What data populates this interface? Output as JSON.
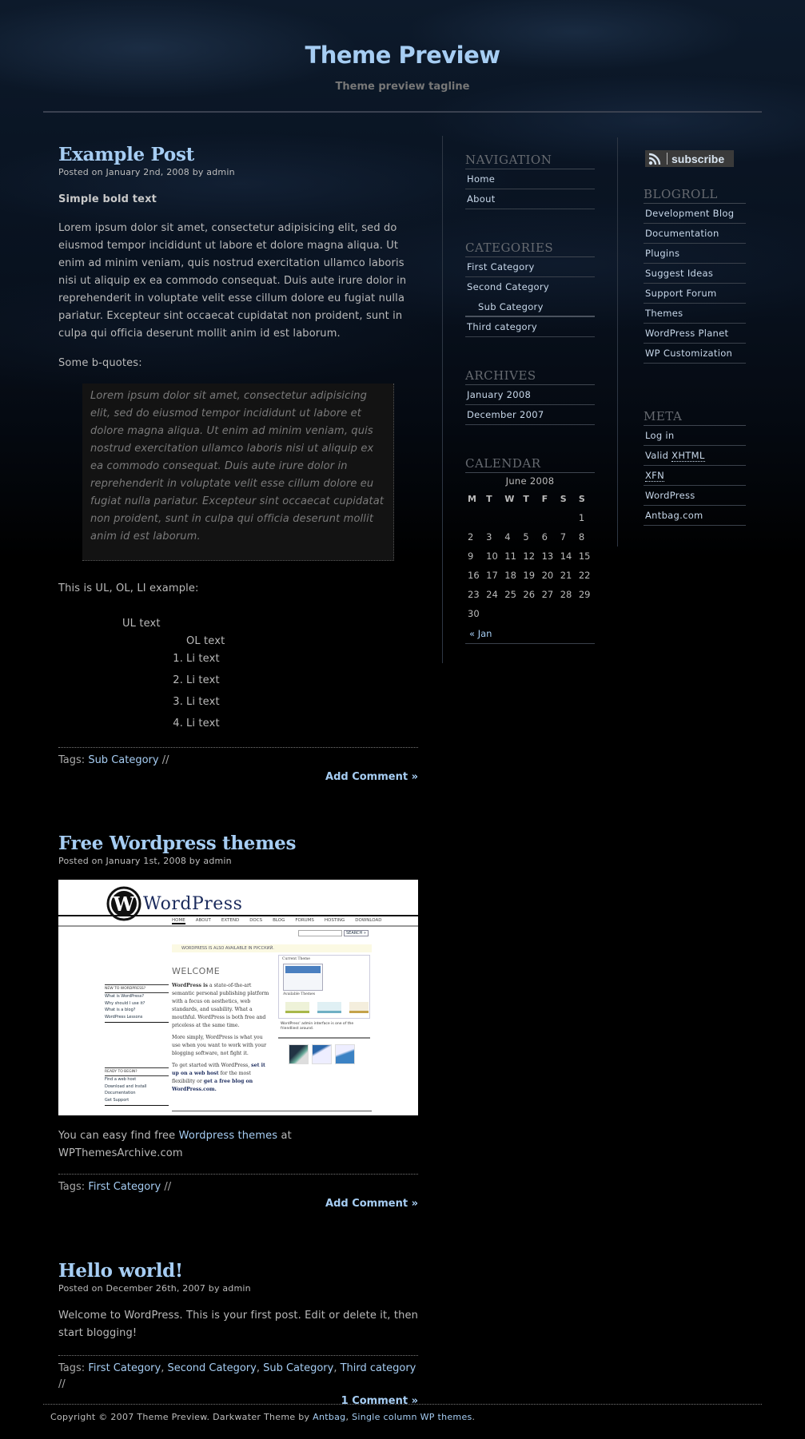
{
  "header": {
    "title": "Theme Preview",
    "tagline": "Theme preview tagline"
  },
  "posts": [
    {
      "title": "Example Post",
      "meta": "Posted on January 2nd, 2008 by admin",
      "bold_text": "Simple bold text",
      "paragraph": "Lorem ipsum dolor sit amet, consectetur adipisicing elit, sed do eiusmod tempor incididunt ut labore et dolore magna aliqua. Ut enim ad minim veniam, quis nostrud exercitation ullamco laboris nisi ut aliquip ex ea commodo consequat. Duis aute irure dolor in reprehenderit in voluptate velit esse cillum dolore eu fugiat nulla pariatur. Excepteur sint occaecat cupidatat non proident, sunt in culpa qui officia deserunt mollit anim id est laborum.",
      "bquote_intro": "Some b-quotes:",
      "blockquote": "Lorem ipsum dolor sit amet, consectetur adipisicing elit, sed do eiusmod tempor incididunt ut labore et dolore magna aliqua. Ut enim ad minim veniam, quis nostrud exercitation ullamco laboris nisi ut aliquip ex ea commodo consequat. Duis aute irure dolor in reprehenderit in voluptate velit esse cillum dolore eu fugiat nulla pariatur. Excepteur sint occaecat cupidatat non proident, sunt in culpa qui officia deserunt mollit anim id est laborum.",
      "list_intro": "This is UL, OL, LI example:",
      "ul_text": "UL text",
      "ol_text": "OL text",
      "li_items": [
        {
          "num": "1.",
          "text": "Li text"
        },
        {
          "num": "2.",
          "text": "Li text"
        },
        {
          "num": "3.",
          "text": "Li text"
        },
        {
          "num": "4.",
          "text": "Li text"
        }
      ],
      "tags_label": "Tags:",
      "tags": [
        "Sub Category"
      ],
      "tags_suffix": " //",
      "comment_link": "Add Comment »"
    },
    {
      "title": "Free Wordpress themes",
      "meta": "Posted on January 1st, 2008 by admin",
      "image": {
        "logo_text": "WordPress",
        "nav": [
          "HOME",
          "ABOUT",
          "EXTEND",
          "DOCS",
          "BLOG",
          "FORUMS",
          "HOSTING",
          "DOWNLOAD"
        ],
        "search_button": "SEARCH »",
        "notice": "WORDPRESS IS ALSO AVAILABLE IN РУССКИЙ.",
        "welcome": "WELCOME",
        "new_heading": "NEW TO WORDPRESS?",
        "new_links": [
          "What is WordPress?",
          "Why should I use it?",
          "What is a blog?",
          "WordPress Lessons"
        ],
        "ready_heading": "READY TO BEGIN?",
        "ready_links": [
          "Find a web host",
          "Download and Install",
          "Documentation",
          "Get Support"
        ],
        "intro_bold": "WordPress is",
        "intro": " a state-of-the-art semantic personal publishing platform with a focus on aesthetics, web standards, and usability. What a mouthful. WordPress is both free and priceless at the same time.",
        "simply": "More simply, WordPress is what you use when you want to work with your blogging software, not fight it.",
        "started": "To get started with WordPress, ",
        "started_link1": "set it up on a web host",
        "started_mid": " for the most flexibility or ",
        "started_link2": "get a free blog on WordPress.com.",
        "current_theme": "Current Theme",
        "available_themes": "Available Themes",
        "caption": "WordPress' admin interface is one of the friendliest around."
      },
      "text_before": "You can easy find free ",
      "text_link": "Wordpress themes",
      "text_after": " at WPThemesArchive.com",
      "tags_label": "Tags:",
      "tags": [
        "First Category"
      ],
      "tags_suffix": " //",
      "comment_link": "Add Comment »"
    },
    {
      "title": "Hello world!",
      "meta": "Posted on December 26th, 2007 by admin",
      "paragraph": "Welcome to WordPress. This is your first post. Edit or delete it, then start blogging!",
      "tags_label": "Tags:",
      "tags": [
        "First Category",
        "Second Category",
        "Sub Category",
        "Third category"
      ],
      "tags_suffix": " //",
      "comment_link": "1 Comment »"
    }
  ],
  "sidebar1": {
    "navigation": {
      "title": "NAVIGATION",
      "items": [
        "Home",
        "About"
      ]
    },
    "categories": {
      "title": "CATEGORIES",
      "items": [
        {
          "label": "First Category",
          "sub": false
        },
        {
          "label": "Second Category",
          "sub": false
        },
        {
          "label": "Sub Category",
          "sub": true
        },
        {
          "label": "Third category",
          "sub": false
        }
      ]
    },
    "archives": {
      "title": "ARCHIVES",
      "items": [
        "January 2008",
        "December 2007"
      ]
    },
    "calendar": {
      "title": "CALENDAR",
      "caption": "June 2008",
      "weekdays": [
        "M",
        "T",
        "W",
        "T",
        "F",
        "S",
        "S"
      ],
      "weeks": [
        [
          "",
          "",
          "",
          "",
          "",
          "",
          "1"
        ],
        [
          "2",
          "3",
          "4",
          "5",
          "6",
          "7",
          "8"
        ],
        [
          "9",
          "10",
          "11",
          "12",
          "13",
          "14",
          "15"
        ],
        [
          "16",
          "17",
          "18",
          "19",
          "20",
          "21",
          "22"
        ],
        [
          "23",
          "24",
          "25",
          "26",
          "27",
          "28",
          "29"
        ],
        [
          "30",
          "",
          "",
          "",
          "",
          "",
          ""
        ]
      ],
      "prev_link": "« Jan"
    }
  },
  "sidebar2": {
    "subscribe_label": "subscribe",
    "blogroll": {
      "title": "BLOGROLL",
      "items": [
        "Development Blog",
        "Documentation",
        "Plugins",
        "Suggest Ideas",
        "Support Forum",
        "Themes",
        "WordPress Planet",
        "WP Customization"
      ]
    },
    "meta": {
      "title": "META",
      "items": [
        {
          "pre": "Log in",
          "abbr": ""
        },
        {
          "pre": "Valid ",
          "abbr": "XHTML"
        },
        {
          "pre": "",
          "abbr": "XFN"
        },
        {
          "pre": "WordPress",
          "abbr": ""
        },
        {
          "pre": "Antbag.com",
          "abbr": ""
        }
      ]
    }
  },
  "footer": {
    "text_before": "Copyright © 2007 Theme Preview. Darkwater Theme by ",
    "link1": "Antbag",
    "sep": ", ",
    "link2": "Single column WP themes",
    "text_after": "."
  },
  "colors": {
    "accent": "#a6cdf3",
    "text": "#bababa",
    "background": "#000000",
    "widget_title": "#666a70"
  }
}
